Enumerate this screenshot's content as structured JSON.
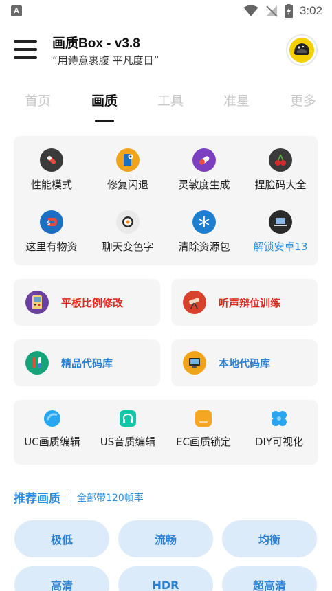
{
  "status_bar": {
    "notification_badge": "A",
    "time": "3:02"
  },
  "header": {
    "title": "画质Box - v3.8",
    "subtitle": "“用诗意裹腹 平凡度日”"
  },
  "tabs": [
    "首页",
    "画质",
    "工具",
    "准星",
    "更多"
  ],
  "active_tab": "画质",
  "feature_grid": [
    {
      "label": "性能模式",
      "icon": "rocket-icon",
      "color": "#3a3a3a"
    },
    {
      "label": "修复闪退",
      "icon": "phone-repair-icon",
      "color": "#f1a41a"
    },
    {
      "label": "灵敏度生成",
      "icon": "pill-icon",
      "color": "#7b3fbf"
    },
    {
      "label": "捏脸码大全",
      "icon": "cherry-icon",
      "color": "#3a3a3a"
    },
    {
      "label": "这里有物资",
      "icon": "magnet-icon",
      "color": "#1e6fbf"
    },
    {
      "label": "聊天变色字",
      "icon": "sushi-icon",
      "color": "#e9e9e9"
    },
    {
      "label": "清除资源包",
      "icon": "snowflake-icon",
      "color": "#1e7fd0"
    },
    {
      "label": "解锁安卓13",
      "icon": "laptop-icon",
      "color": "#2a2a2a",
      "highlight": true
    }
  ],
  "row_cards": [
    {
      "label": "平板比例修改",
      "icon": "gameboy-icon",
      "color": "#6a3fa0",
      "tone": "red"
    },
    {
      "label": "听声辩位训练",
      "icon": "telescope-icon",
      "color": "#d8422c",
      "tone": "red"
    },
    {
      "label": "精品代码库",
      "icon": "test-tube-icon",
      "color": "#17a37a",
      "tone": "blue"
    },
    {
      "label": "本地代码库",
      "icon": "computer-icon",
      "color": "#f0a41a",
      "tone": "blue"
    }
  ],
  "tools": [
    {
      "label": "UC画质编辑",
      "icon": "uc-icon",
      "color": "#2aa6f0"
    },
    {
      "label": "US音质编辑",
      "icon": "headphones-icon",
      "color": "#14c6a8"
    },
    {
      "label": "EC画质锁定",
      "icon": "lock-card-icon",
      "color": "#f5a623"
    },
    {
      "label": "DIY可视化",
      "icon": "diy-icon",
      "color": "#2aa6f0"
    }
  ],
  "recommend": {
    "title": "推荐画质",
    "subtitle": "全部带120帧率"
  },
  "quality_options": [
    "极低",
    "流畅",
    "均衡",
    "高清",
    "HDR",
    "超高清"
  ]
}
